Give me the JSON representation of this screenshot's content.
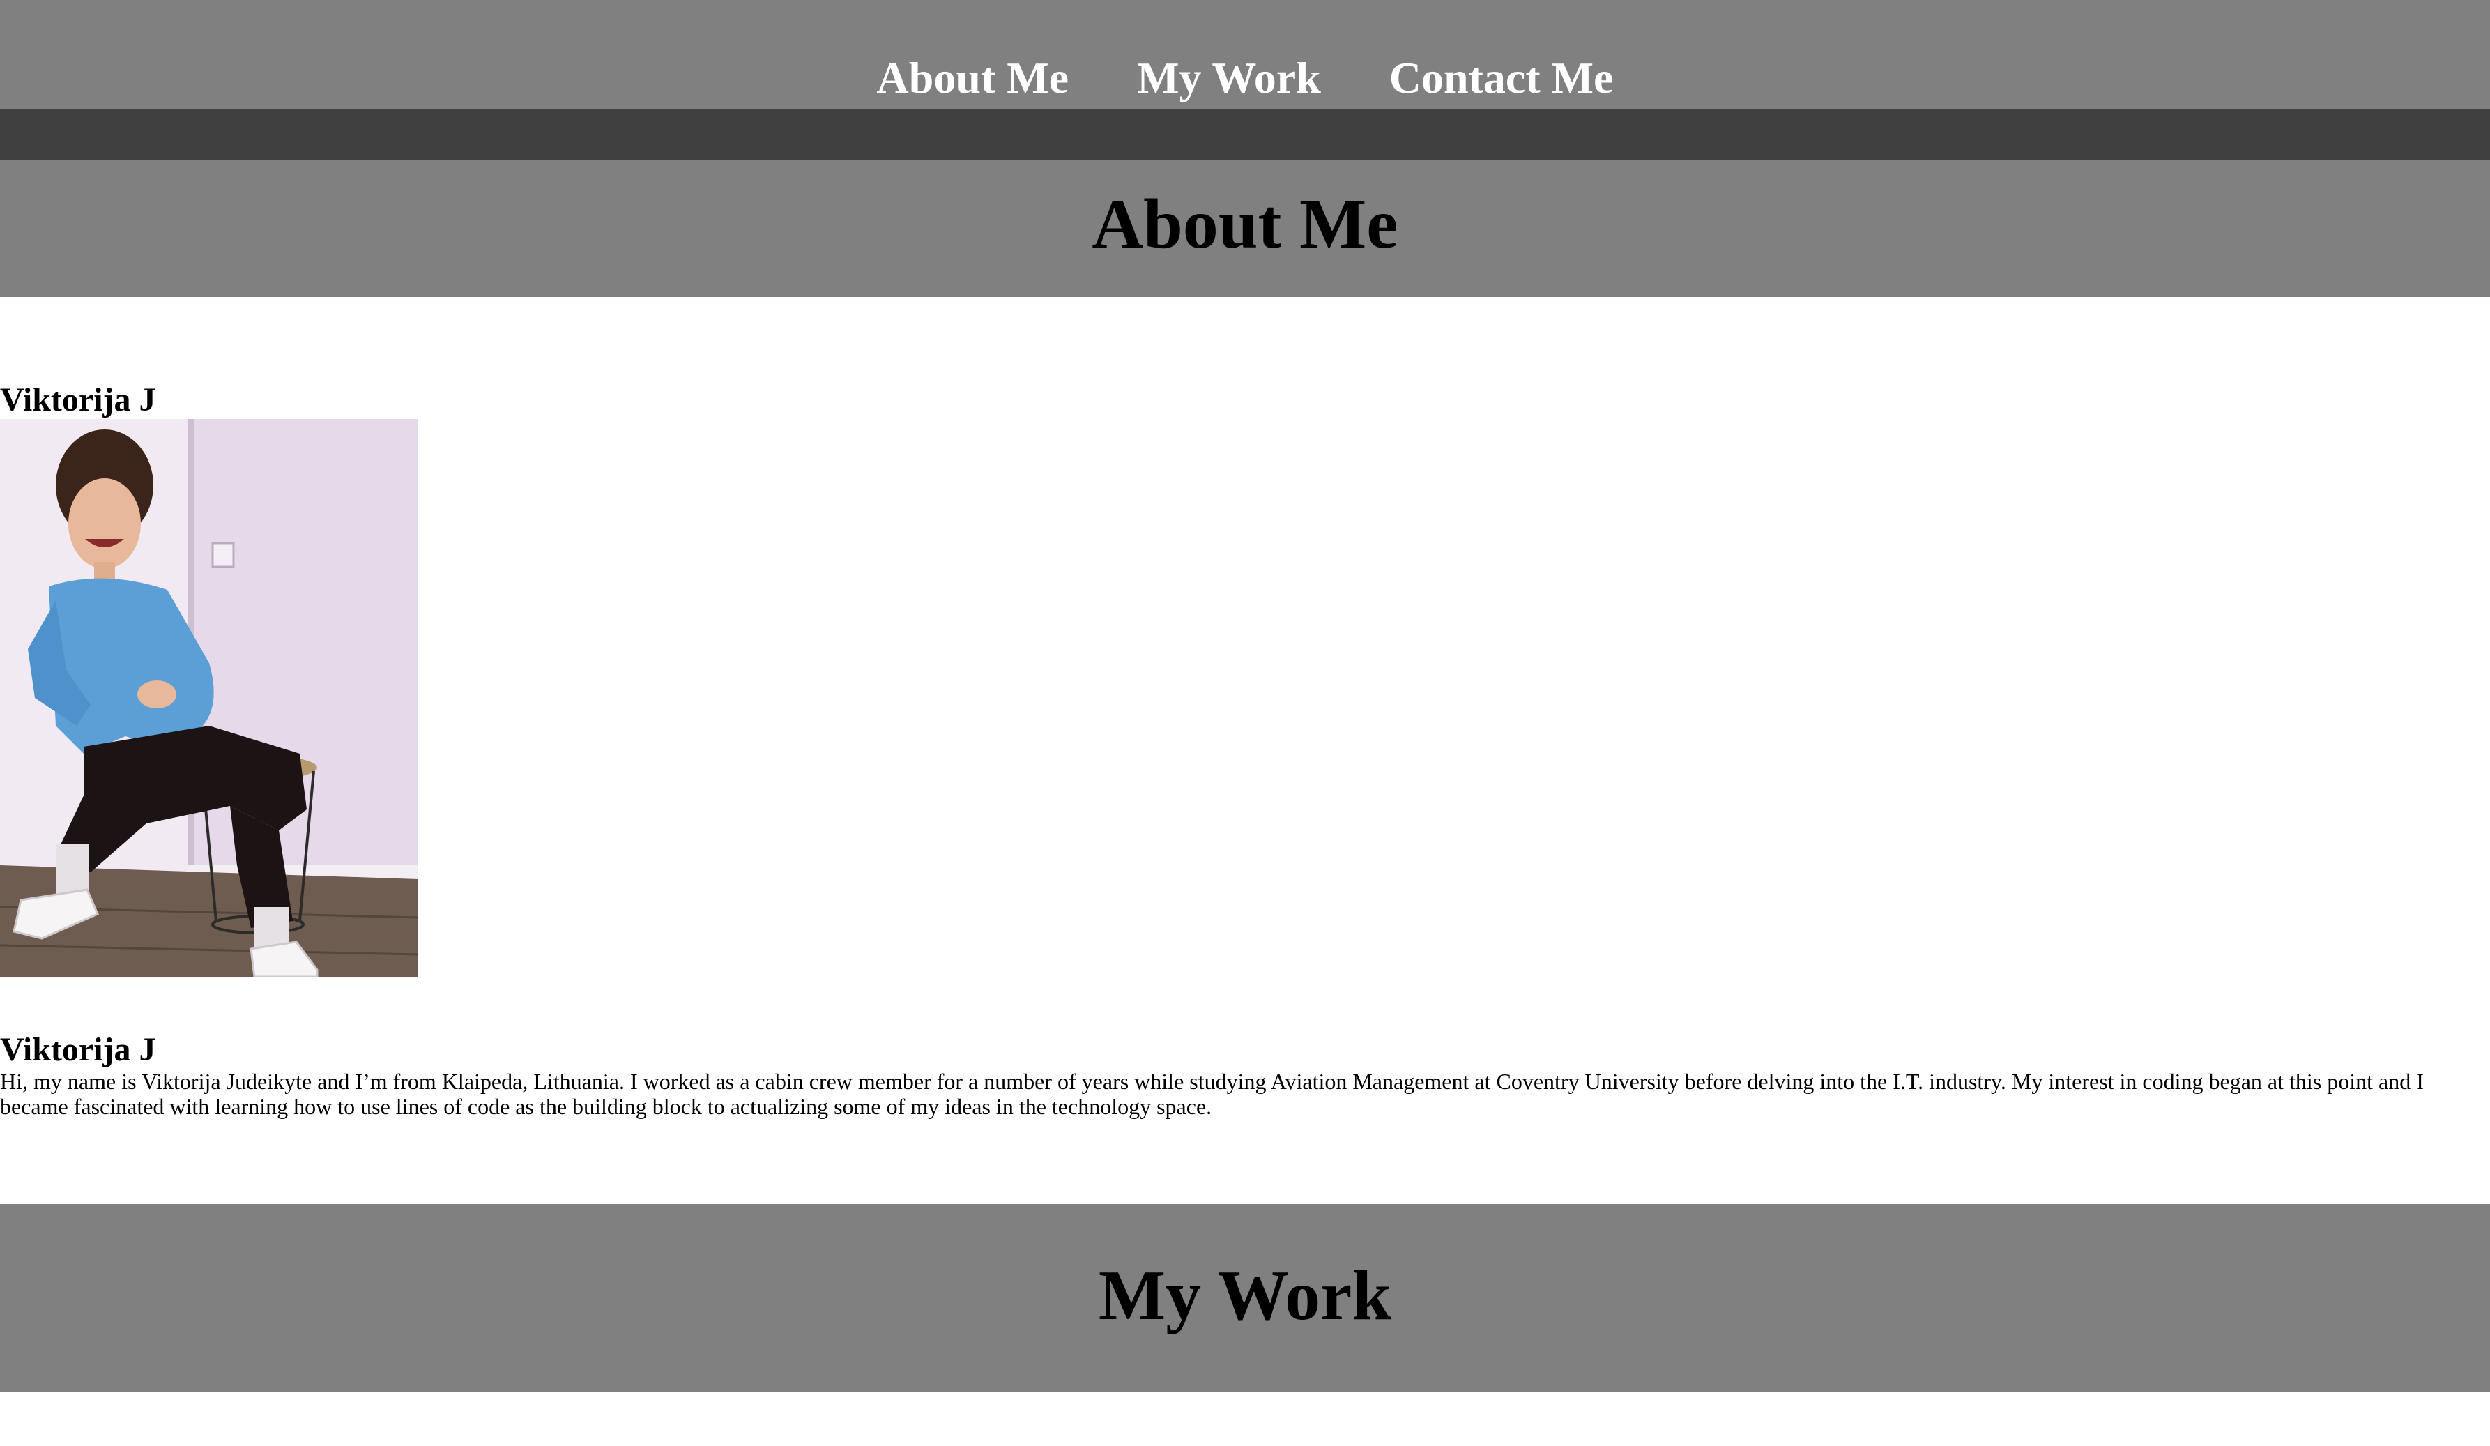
{
  "nav": {
    "items": [
      {
        "label": "About Me"
      },
      {
        "label": "My Work"
      },
      {
        "label": "Contact Me"
      }
    ]
  },
  "about": {
    "heading": "About Me",
    "name_top": "Viktorija J",
    "name_bottom": "Viktorija J",
    "photo_icon": "profile-photo",
    "bio": "Hi, my name is Viktorija Judeikyte and I’m from Klaipeda, Lithuania. I worked as a cabin crew member for a number of years while studying Aviation Management at Coventry University before delving into the I.T. industry. My interest in coding began at this point and I became fascinated with learning how to use lines of code as the building block to actualizing some of my ideas in the technology space."
  },
  "work": {
    "heading": "My Work"
  },
  "colors": {
    "nav_bg": "#808080",
    "nav_strip": "#404040",
    "header_bg": "#808080",
    "nav_text": "#ffffff",
    "page_bg": "#ffffff"
  }
}
